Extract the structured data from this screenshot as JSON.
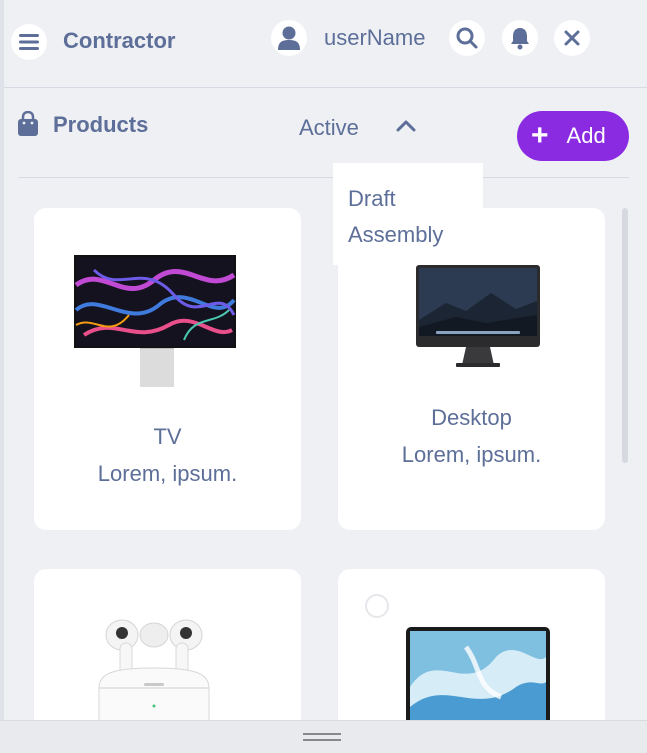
{
  "header": {
    "title": "Contractor",
    "username": "userName"
  },
  "toolbar": {
    "section_title": "Products",
    "status_value": "Active",
    "add_label": "Add",
    "status_options": [
      "Draft",
      "Assembly"
    ]
  },
  "products": [
    {
      "name": "TV",
      "description": "Lorem, ipsum."
    },
    {
      "name": "Desktop",
      "description": "Lorem, ipsum."
    }
  ],
  "colors": {
    "accent": "#8a2be2",
    "text": "#5d6f99",
    "background": "#eef0f4"
  }
}
